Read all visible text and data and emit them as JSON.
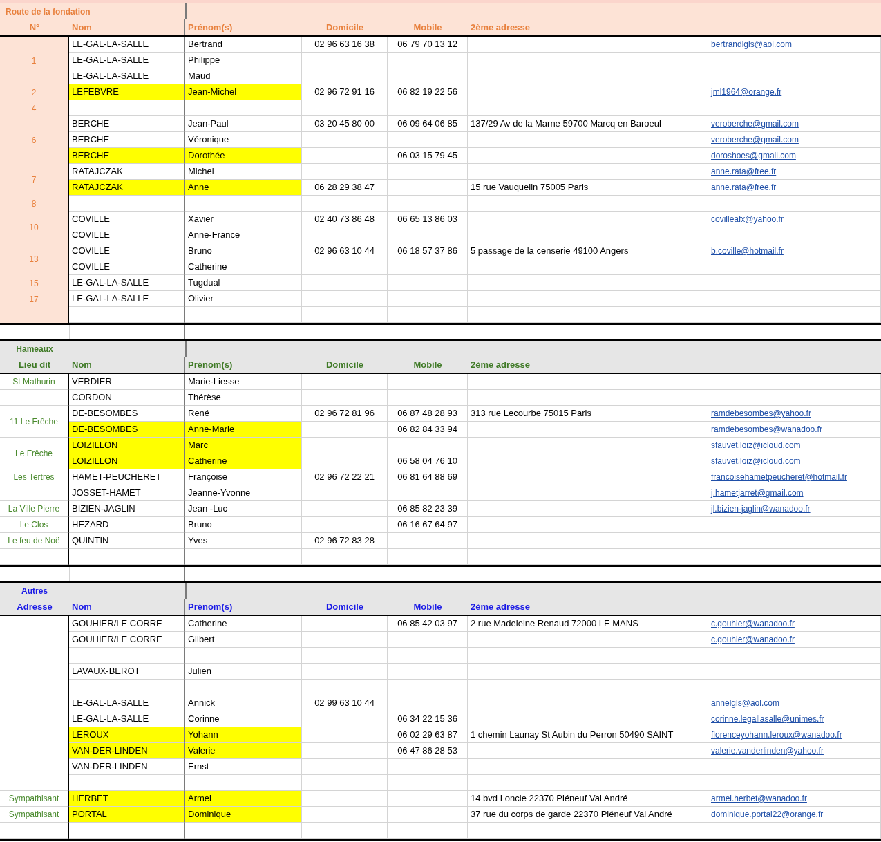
{
  "sections": [
    {
      "kind": "fondation",
      "title": "Route de la fondation",
      "headers": [
        "N°",
        "Nom",
        "Prénom(s)",
        "Domicile",
        "Mobile",
        "2ème adresse"
      ],
      "groups": [
        {
          "label": "1",
          "rows": [
            {
              "nom": "LE-GAL-LA-SALLE",
              "prenom": "Bertrand",
              "domicile": "02 96 63 16 38",
              "mobile": "06 79 70 13 12",
              "email": "bertrandlgls@aol.com",
              "highlighted": false
            },
            {
              "nom": "LE-GAL-LA-SALLE",
              "prenom": "Philippe",
              "highlighted": false
            },
            {
              "nom": "LE-GAL-LA-SALLE",
              "prenom": "Maud",
              "highlighted": false
            }
          ]
        },
        {
          "label": "2",
          "rows": [
            {
              "nom": "LEFEBVRE",
              "prenom": "Jean-Michel",
              "domicile": "02 96 72 91 16",
              "mobile": "06 82 19 22 56",
              "email": "jml1964@orange.fr",
              "highlighted": true
            }
          ]
        },
        {
          "label": "4",
          "rows": [
            {
              "highlighted": false
            }
          ]
        },
        {
          "label": "6",
          "rows": [
            {
              "nom": "BERCHE",
              "prenom": "Jean-Paul",
              "domicile": "03 20 45 80 00",
              "mobile": "06 09 64 06 85",
              "adresse": "137/29 Av de la Marne 59700 Marcq en Baroeul",
              "email": "veroberche@gmail.com",
              "highlighted": false
            },
            {
              "nom": "BERCHE",
              "prenom": "Véronique",
              "email": "veroberche@gmail.com",
              "highlighted": false
            },
            {
              "nom": "BERCHE",
              "prenom": "Dorothée",
              "mobile": "06 03 15 79 45",
              "email": "doroshoes@gmail.com",
              "highlighted": true
            }
          ]
        },
        {
          "label": "7",
          "rows": [
            {
              "nom": "RATAJCZAK",
              "prenom": "Michel",
              "email": "anne.rata@free.fr",
              "highlighted": false
            },
            {
              "nom": "RATAJCZAK",
              "prenom": "Anne",
              "domicile": "06 28 29 38 47",
              "adresse": "15 rue Vauquelin 75005 Paris",
              "email": "anne.rata@free.fr",
              "highlighted": true
            }
          ]
        },
        {
          "label": "8",
          "rows": [
            {
              "highlighted": false
            }
          ]
        },
        {
          "label": "10",
          "rows": [
            {
              "nom": "COVILLE",
              "prenom": "Xavier",
              "domicile": "02 40 73 86 48",
              "mobile": "06 65 13 86 03",
              "email": "covilleafx@yahoo.fr",
              "highlighted": false
            },
            {
              "nom": "COVILLE",
              "prenom": "Anne-France",
              "highlighted": false
            }
          ]
        },
        {
          "label": "13",
          "rows": [
            {
              "nom": "COVILLE",
              "prenom": "Bruno",
              "domicile": "02 96 63 10 44",
              "mobile": "06 18 57 37 86",
              "adresse": "5 passage de la censerie 49100 Angers",
              "email": "b.coville@hotmail.fr",
              "highlighted": false
            },
            {
              "nom": "COVILLE",
              "prenom": "Catherine",
              "highlighted": false
            }
          ]
        },
        {
          "label": "15",
          "rows": [
            {
              "nom": "LE-GAL-LA-SALLE",
              "prenom": "Tugdual",
              "highlighted": false
            }
          ]
        },
        {
          "label": "17",
          "rows": [
            {
              "nom": "LE-GAL-LA-SALLE",
              "prenom": "Olivier",
              "highlighted": false
            }
          ]
        },
        {
          "rows": [
            {
              "highlighted": false
            }
          ]
        }
      ]
    },
    {
      "kind": "hameaux",
      "title": "Hameaux",
      "headers": [
        "Lieu dit",
        "Nom",
        "Prénom(s)",
        "Domicile",
        "Mobile",
        "2ème adresse"
      ],
      "groups": [
        {
          "label": "St Mathurin",
          "rows": [
            {
              "nom": "VERDIER",
              "prenom": "Marie-Liesse",
              "highlighted": false
            }
          ]
        },
        {
          "rows": [
            {
              "nom": "CORDON",
              "prenom": "Thérèse",
              "highlighted": false
            }
          ]
        },
        {
          "label": "11 Le Frêche",
          "rows": [
            {
              "nom": "DE-BESOMBES",
              "prenom": "René",
              "domicile": "02 96 72 81 96",
              "mobile": "06 87 48 28 93",
              "adresse": "313 rue Lecourbe 75015 Paris",
              "email": "ramdebesombes@yahoo.fr",
              "highlighted": false
            },
            {
              "nom": "DE-BESOMBES",
              "prenom": "Anne-Marie",
              "mobile": "06 82 84 33 94",
              "email": "ramdebesombes@wanadoo.fr",
              "highlighted": true
            }
          ]
        },
        {
          "label": "Le Frêche",
          "rows": [
            {
              "nom": "LOIZILLON",
              "prenom": "Marc",
              "email": "sfauvet.loiz@icloud.com",
              "highlighted": true
            },
            {
              "nom": "LOIZILLON",
              "prenom": "Catherine",
              "mobile": "06 58 04 76 10",
              "email": "sfauvet.loiz@icloud.com",
              "highlighted": true
            }
          ]
        },
        {
          "label": "Les Tertres",
          "rows": [
            {
              "nom": "HAMET-PEUCHERET",
              "prenom": "Françoise",
              "domicile": "02 96 72 22 21",
              "mobile": "06 81 64 88 69",
              "email": "francoisehametpeucheret@hotmail.fr",
              "highlighted": false
            }
          ]
        },
        {
          "rows": [
            {
              "nom": "JOSSET-HAMET",
              "prenom": "Jeanne-Yvonne",
              "email": "j.hametjarret@gmail.com",
              "highlighted": false
            }
          ]
        },
        {
          "label": "La Ville Pierre",
          "rows": [
            {
              "nom": "BIZIEN-JAGLIN",
              "prenom": "Jean -Luc",
              "mobile": "06 85 82 23 39",
              "email": "jl.bizien-jaglin@wanadoo.fr",
              "highlighted": false
            }
          ]
        },
        {
          "label": "Le Clos",
          "rows": [
            {
              "nom": "HEZARD",
              "prenom": "Bruno",
              "mobile": "06 16 67 64 97",
              "highlighted": false
            }
          ]
        },
        {
          "label": "Le feu de Noë",
          "rows": [
            {
              "nom": "QUINTIN",
              "prenom": "Yves",
              "domicile": "02 96 72 83 28",
              "highlighted": false
            }
          ]
        },
        {
          "rows": [
            {
              "highlighted": false
            }
          ]
        }
      ]
    },
    {
      "kind": "autres",
      "title": "Autres",
      "headers": [
        "Adresse",
        "Nom",
        "Prénom(s)",
        "Domicile",
        "Mobile",
        "2ème adresse"
      ],
      "groups": [
        {
          "rows": [
            {
              "nom": "GOUHIER/LE CORRE",
              "prenom": "Catherine",
              "mobile": "06 85 42 03 97",
              "adresse": "2 rue Madeleine Renaud 72000 LE MANS",
              "email": "c.gouhier@wanadoo.fr",
              "highlighted": false
            },
            {
              "nom": "GOUHIER/LE CORRE",
              "prenom": "Gilbert",
              "email": "c.gouhier@wanadoo.fr",
              "highlighted": false
            },
            {
              "highlighted": false
            },
            {
              "nom": "LAVAUX-BEROT",
              "prenom": "Julien",
              "highlighted": false
            },
            {
              "highlighted": false
            },
            {
              "nom": "LE-GAL-LA-SALLE",
              "prenom": "Annick",
              "domicile": "02 99 63 10 44",
              "email": "annelgls@aol.com",
              "highlighted": false
            },
            {
              "nom": "LE-GAL-LA-SALLE",
              "prenom": "Corinne",
              "mobile": "06 34 22 15 36",
              "email": "corinne.legallasalle@unimes.fr",
              "highlighted": false
            },
            {
              "nom": "LEROUX",
              "prenom": "Yohann",
              "mobile": "06 02 29 63 87",
              "adresse": "1 chemin Launay St Aubin du Perron 50490 SAINT",
              "email": "florenceyohann.leroux@wanadoo.fr",
              "highlighted": true
            },
            {
              "nom": "VAN-DER-LINDEN",
              "prenom": "Valerie",
              "mobile": "06 47 86 28 53",
              "email": "valerie.vanderlinden@yahoo.fr",
              "highlighted": true
            },
            {
              "nom": "VAN-DER-LINDEN",
              "prenom": "Ernst",
              "highlighted": false
            },
            {
              "highlighted": false
            }
          ]
        },
        {
          "label": "Sympathisant",
          "rows": [
            {
              "nom": "HERBET",
              "prenom": "Armel",
              "adresse": "14 bvd Loncle 22370 Pléneuf Val André",
              "email": "armel.herbet@wanadoo.fr",
              "highlighted": true
            }
          ]
        },
        {
          "label": "Sympathisant",
          "rows": [
            {
              "nom": "PORTAL",
              "prenom": "Dominique",
              "adresse": "37 rue du corps de garde 22370 Pléneuf Val André",
              "email": "dominique.portal22@orange.fr",
              "highlighted": true
            }
          ]
        },
        {
          "rows": [
            {
              "highlighted": false
            }
          ]
        }
      ]
    }
  ]
}
